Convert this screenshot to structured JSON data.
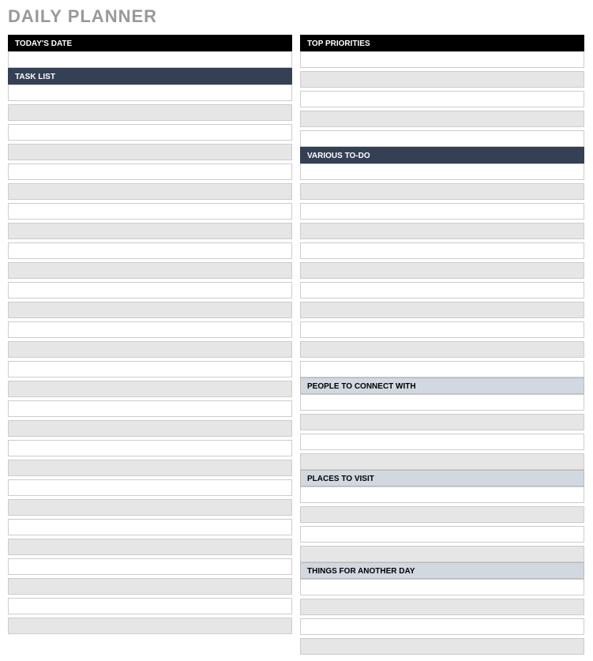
{
  "title": "DAILY PLANNER",
  "left": {
    "todays_date_label": "TODAY'S DATE",
    "task_list_label": "TASK LIST"
  },
  "right": {
    "top_priorities_label": "TOP PRIORITIES",
    "various_todo_label": "VARIOUS TO-DO",
    "people_to_connect_label": "PEOPLE TO CONNECT WITH",
    "places_to_visit_label": "PLACES TO VISIT",
    "things_another_day_label": "THINGS FOR ANOTHER DAY"
  }
}
